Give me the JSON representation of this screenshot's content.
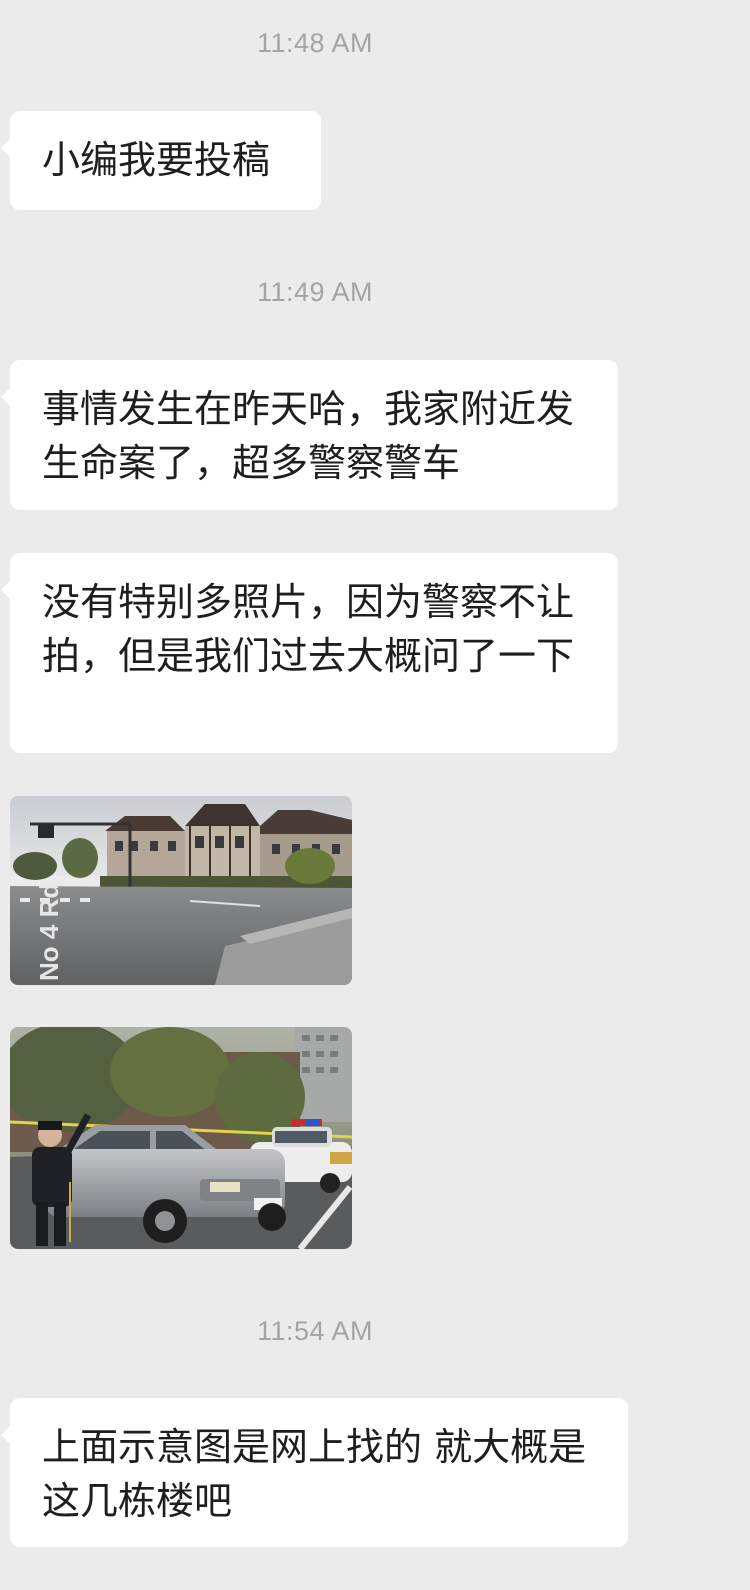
{
  "messages": [
    {
      "type": "timestamp",
      "text": "11:48 AM"
    },
    {
      "type": "text",
      "text": "小编我要投稿"
    },
    {
      "type": "timestamp",
      "text": "11:49 AM"
    },
    {
      "type": "text",
      "text": "事情发生在昨天哈，我家附近发生命案了，超多警察警车"
    },
    {
      "type": "text",
      "text": "没有特别多照片，因为警察不让拍，但是我们过去大概问了一下"
    },
    {
      "type": "image",
      "description": "street-intersection-photo",
      "road_label": "No 4 Rd"
    },
    {
      "type": "image",
      "description": "police-scene-photo"
    },
    {
      "type": "timestamp",
      "text": "11:54 AM"
    },
    {
      "type": "text",
      "text": "上面示意图是网上找的 就大概是这几栋楼吧"
    }
  ],
  "colors": {
    "background": "#ebebeb",
    "bubble": "#ffffff",
    "text": "#1e1e1e",
    "timestamp": "#a4a4a4"
  }
}
